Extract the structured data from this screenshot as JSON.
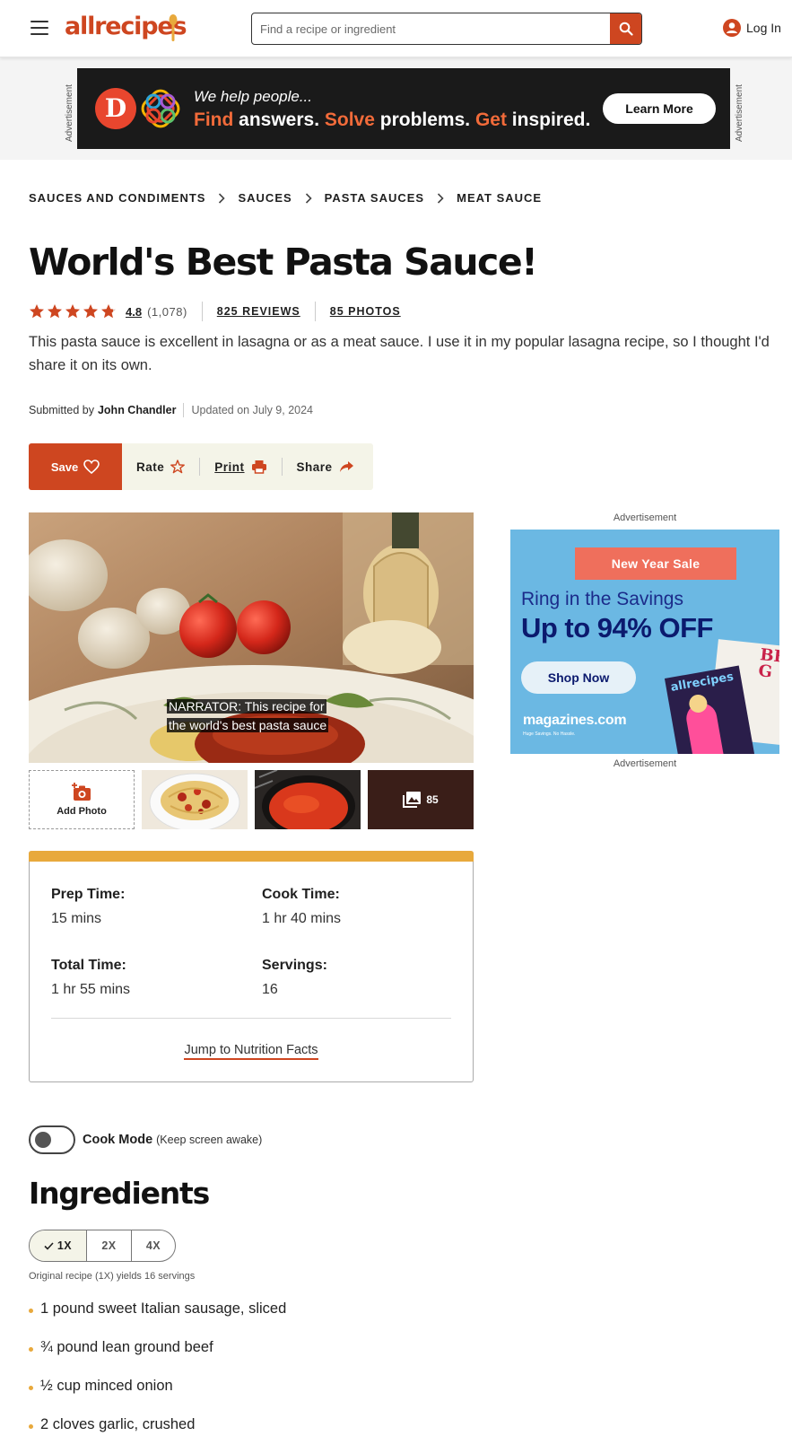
{
  "header": {
    "logo_text": "allrecipes",
    "search_placeholder": "Find a recipe or ingredient",
    "login_label": "Log In"
  },
  "top_ad": {
    "label": "Advertisement",
    "tagline": "We help people...",
    "headline_w1": "Find",
    "headline_w2": " answers. ",
    "headline_w3": "Solve",
    "headline_w4": " problems. ",
    "headline_w5": "Get",
    "headline_w6": " inspired.",
    "cta": "Learn More",
    "logo_letter": "D"
  },
  "breadcrumb": [
    "SAUCES AND CONDIMENTS",
    "SAUCES",
    "PASTA SAUCES",
    "MEAT SAUCE"
  ],
  "recipe": {
    "title": "World's Best Pasta Sauce!",
    "rating": "4.8",
    "rating_count": "(1,078)",
    "rating_stars": 4.8,
    "reviews": "825 REVIEWS",
    "photos": "85 PHOTOS",
    "description": "This pasta sauce is excellent in lasagna or as a meat sauce. I use it in my popular lasagna recipe, so I thought I'd share it on its own.",
    "submitted_by": "Submitted by",
    "author": "John Chandler",
    "updated": "Updated on July 9, 2024"
  },
  "actions": {
    "save": "Save",
    "rate": "Rate",
    "print": "Print",
    "share": "Share"
  },
  "video": {
    "caption_line1": "NARRATOR: This recipe for",
    "caption_line2": "the world's best pasta sauce"
  },
  "thumbs": {
    "add_photo": "Add Photo",
    "more_count": "85"
  },
  "right_ad": {
    "label_top": "Advertisement",
    "label_bottom": "Advertisement",
    "ribbon": "New Year Sale",
    "line1": "Ring in the Savings",
    "line2": "Up to 94% OFF",
    "cta": "Shop Now",
    "brand": "magazines.com",
    "brand_sub": "Huge Savings. No Hassle.",
    "mag_title": "allrecipes",
    "mag_bhg": "BH G"
  },
  "times": {
    "prep_label": "Prep Time:",
    "prep_value": "15 mins",
    "cook_label": "Cook Time:",
    "cook_value": "1 hr 40 mins",
    "total_label": "Total Time:",
    "total_value": "1 hr 55 mins",
    "servings_label": "Servings:",
    "servings_value": "16",
    "jump_label": "Jump to Nutrition Facts"
  },
  "cook_mode": {
    "label": "Cook Mode",
    "sub": "(Keep screen awake)",
    "enabled": false
  },
  "ingredients": {
    "title": "Ingredients",
    "scale_options": [
      "1X",
      "2X",
      "4X"
    ],
    "selected_scale": "1X",
    "yield_note": "Original recipe (1X) yields 16 servings",
    "items": [
      "1 pound sweet Italian sausage, sliced",
      "¾ pound lean ground beef",
      "½ cup minced onion",
      "2 cloves garlic, crushed"
    ]
  },
  "colors": {
    "brand": "#ce4620",
    "gold": "#e8a93c",
    "cream": "#f4f4e8"
  }
}
